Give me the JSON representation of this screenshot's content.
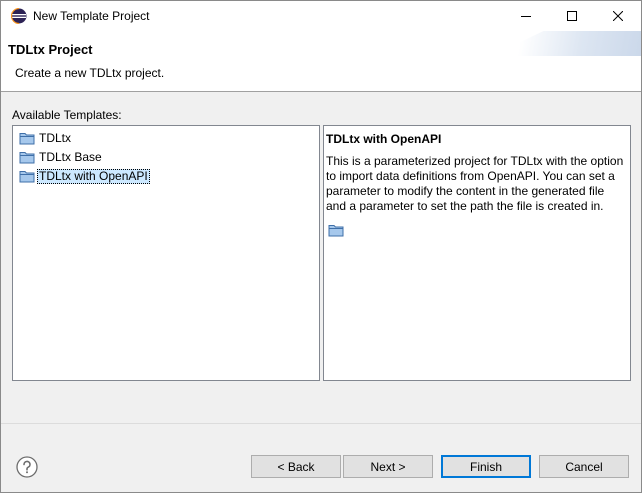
{
  "window": {
    "title": "New Template Project",
    "controls": {
      "minimize_icon": "minimize-icon",
      "maximize_icon": "maximize-icon",
      "close_icon": "close-icon"
    }
  },
  "header": {
    "title": "TDLtx Project",
    "description": "Create a new TDLtx project."
  },
  "templates": {
    "label": "Available Templates:",
    "items": [
      {
        "label": "TDLtx",
        "icon": "folder-icon",
        "selected": false
      },
      {
        "label": "TDLtx Base",
        "icon": "folder-icon",
        "selected": false
      },
      {
        "label": "TDLtx with OpenAPI",
        "icon": "folder-icon",
        "selected": true
      }
    ]
  },
  "details": {
    "title": "TDLtx with OpenAPI",
    "text": "This is a parameterized project for TDLtx with the option to import data definitions from OpenAPI. You can set a parameter to modify the content in the generated file and a parameter to set the path the file is created in.",
    "icon": "folder-icon"
  },
  "footer": {
    "help_icon": "help-icon",
    "back_label": "< Back",
    "next_label": "Next >",
    "finish_label": "Finish",
    "cancel_label": "Cancel"
  },
  "colors": {
    "selection": "#cce8ff",
    "default_button_border": "#0078d7",
    "folder": "#a6c8ec"
  }
}
